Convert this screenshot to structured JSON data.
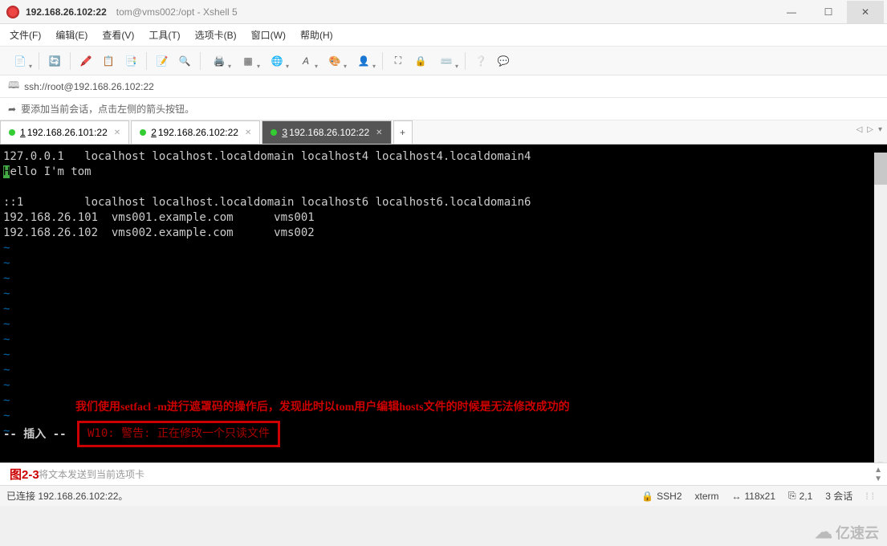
{
  "title": {
    "main": "192.168.26.102:22",
    "sub": "tom@vms002:/opt - Xshell 5"
  },
  "menu": {
    "file": "文件(F)",
    "edit": "编辑(E)",
    "view": "查看(V)",
    "tools": "工具(T)",
    "tabs": "选项卡(B)",
    "window": "窗口(W)",
    "help": "帮助(H)"
  },
  "address": "ssh://root@192.168.26.102:22",
  "hint": "要添加当前会话，点击左侧的箭头按钮。",
  "tabs": [
    {
      "n": "1",
      "label": "192.168.26.101:22",
      "active": false
    },
    {
      "n": "2",
      "label": "192.168.26.102:22",
      "active": false
    },
    {
      "n": "3",
      "label": "192.168.26.102:22",
      "active": true
    }
  ],
  "terminal": {
    "lines": [
      "127.0.0.1   localhost localhost.localdomain localhost4 localhost4.localdomain4",
      "Hello I'm tom",
      "",
      "::1         localhost localhost.localdomain localhost6 localhost6.localdomain6",
      "192.168.26.101  vms001.example.com      vms001",
      "192.168.26.102  vms002.example.com      vms002"
    ],
    "cursor_char": "H",
    "insert": "-- 插入 --",
    "warn": "W10: 警告: 正在修改一个只读文件",
    "annotation": "我们使用setfacl -m进行遮罩码的操作后，发现此时以tom用户编辑hosts文件的时候是无法修改成功的"
  },
  "inputrow": {
    "placeholder": "将文本发送到当前选项卡",
    "fig": "图2-3"
  },
  "status": {
    "connected": "已连接 192.168.26.102:22。",
    "ssh": "SSH2",
    "term": "xterm",
    "size": "118x21",
    "pos": "2,1",
    "sessions": "3 会话"
  },
  "watermark": "亿速云"
}
